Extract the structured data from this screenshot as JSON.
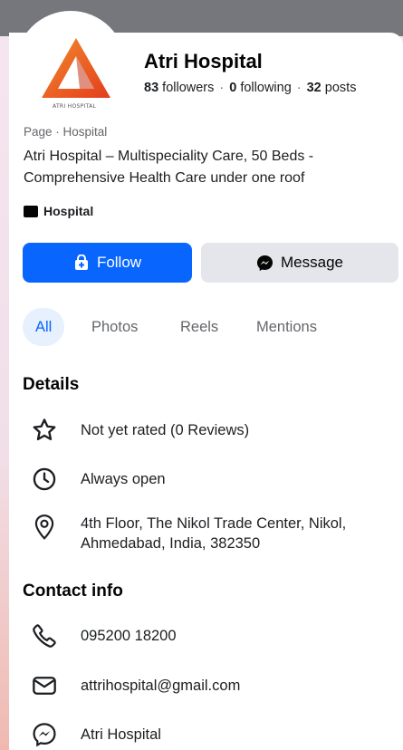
{
  "page": {
    "title": "Atri Hospital",
    "logo_text": "ATRI HOSPITAL",
    "stats": {
      "followers_count": "83",
      "followers_label": "followers",
      "following_count": "0",
      "following_label": "following",
      "posts_count": "32",
      "posts_label": "posts",
      "separator": "·"
    },
    "category": "Page · Hospital",
    "bio": "Atri Hospital – Multispeciality Care, 50 Beds - Comprehensive Health Care under one roof",
    "tag": "Hospital"
  },
  "actions": {
    "follow_label": "Follow",
    "message_label": "Message"
  },
  "tabs": [
    {
      "label": "All",
      "active": true
    },
    {
      "label": "Photos",
      "active": false
    },
    {
      "label": "Reels",
      "active": false
    },
    {
      "label": "Mentions",
      "active": false
    }
  ],
  "details": {
    "title": "Details",
    "rating": "Not yet rated (0 Reviews)",
    "hours": "Always open",
    "address": "4th Floor, The Nikol Trade Center, Nikol, Ahmedabad, India, 382350"
  },
  "contact": {
    "title": "Contact info",
    "phone": "095200 18200",
    "email": "attrihospital@gmail.com",
    "messenger": "Atri Hospital"
  },
  "colors": {
    "brand_blue": "#0866ff",
    "logo_orange": "#e9531f",
    "secondary_button": "#e4e6eb"
  }
}
